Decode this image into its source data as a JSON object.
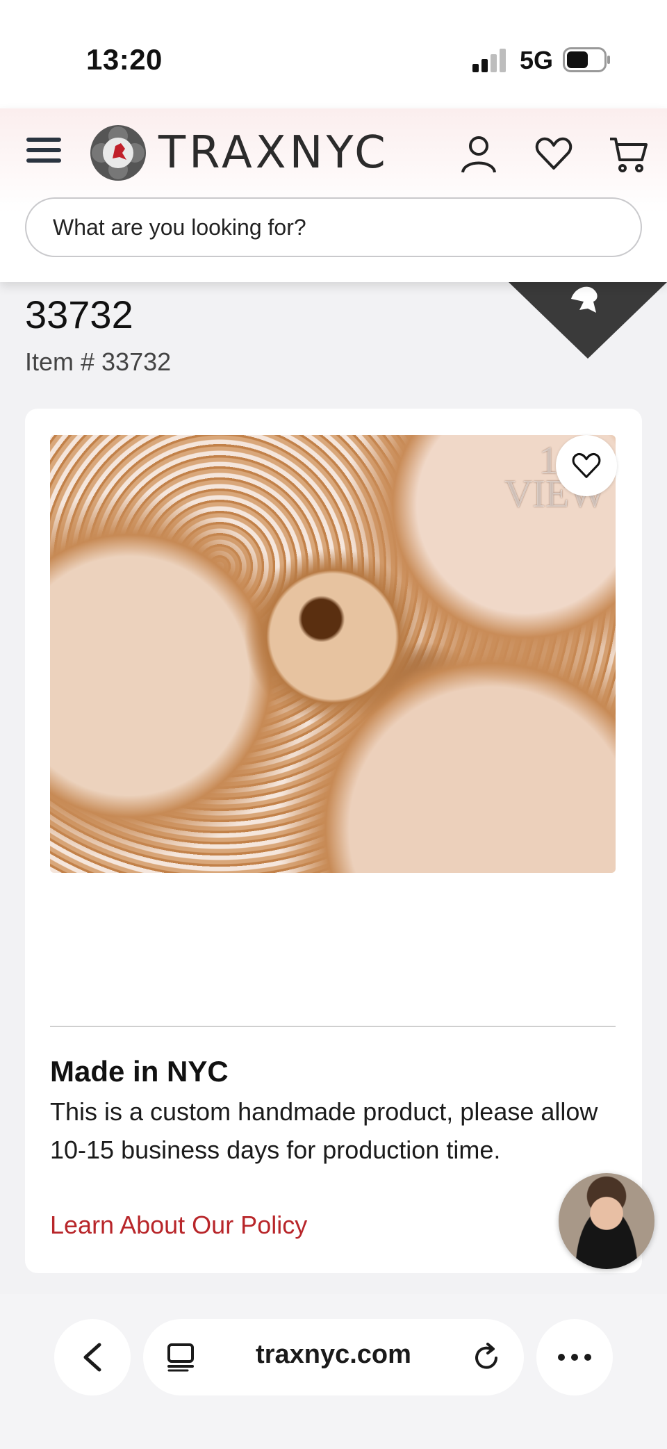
{
  "status_bar": {
    "time": "13:20",
    "network": "5G"
  },
  "header": {
    "brand": "TRAXNYC",
    "search_placeholder": "What are you looking for?"
  },
  "product": {
    "title": "33732",
    "item_number": "Item # 33732",
    "image_watermark_line1": "10X",
    "image_watermark_line2": "VIEW"
  },
  "info": {
    "heading": "Made in NYC",
    "body": "This is a custom handmade product, please allow 10-15 business days for production time.",
    "link": "Learn About Our Policy"
  },
  "browser": {
    "url": "traxnyc.com"
  },
  "colors": {
    "link": "#b8262a",
    "ribbon": "#3a3a3a",
    "header_tint": "#fbeeee"
  }
}
